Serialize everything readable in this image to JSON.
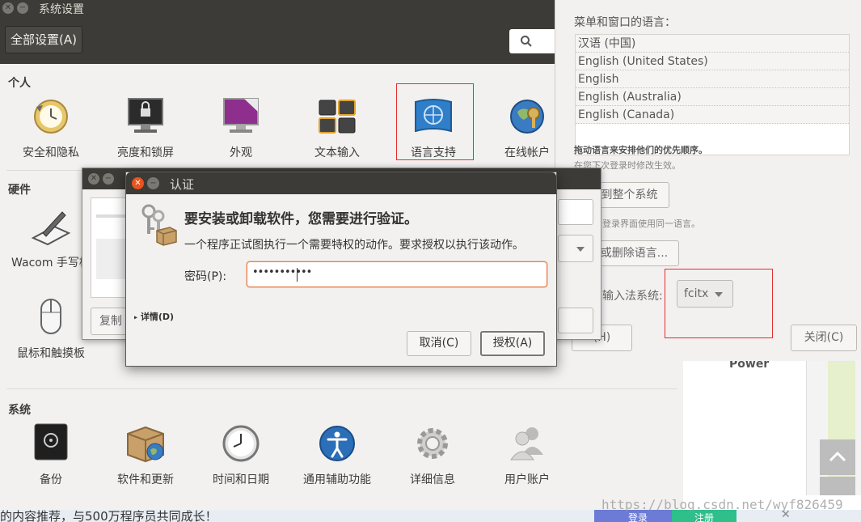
{
  "settings_window": {
    "title": "系统设置",
    "all_settings_button": "全部设置(A)",
    "sections": {
      "personal": {
        "title": "个人",
        "items": [
          "安全和隐私",
          "亮度和锁屏",
          "外观",
          "文本输入",
          "语言支持",
          "在线帐户"
        ]
      },
      "hardware": {
        "title": "硬件",
        "items": [
          "Wacom 手写板",
          "鼠标和触摸板"
        ]
      },
      "system": {
        "title": "系统",
        "items": [
          "备份",
          "软件和更新",
          "时间和日期",
          "通用辅助功能",
          "详细信息",
          "用户账户"
        ]
      }
    },
    "power_label": "Power"
  },
  "language_panel": {
    "menu_language_label": "菜单和窗口的语言：",
    "languages": [
      "汉语 (中国)",
      "English (United States)",
      "English",
      "English (Australia)",
      "English (Canada)"
    ],
    "drag_hint": "拖动语言来安排他们的优先顺序。",
    "effect_hint": "在您下次登录时修改生效。",
    "apply_system_button": "到整个系统",
    "login_hint": "登录界面使用同一语言。",
    "install_remove_button": "或删除语言...",
    "input_method_label": "输入法系统:",
    "input_method_value": "fcitx",
    "help_button": "(H)",
    "close_button": "关闭(C)"
  },
  "background_dialog": {
    "copy_button": "复制"
  },
  "auth_dialog": {
    "title": "认证",
    "heading": "要安装或卸载软件，您需要进行验证。",
    "message": "一个程序正试图执行一个需要特权的动作。要求授权以执行该动作。",
    "password_label": "密码(P):",
    "password_value": "•••••••••••",
    "details_label": "详情(D)",
    "cancel_button": "取消(C)",
    "authorize_button": "授权(A)"
  },
  "bottom_banner": {
    "text": "的内容推荐，与500万程序员共同成长！",
    "login": "登录",
    "register": "注册"
  },
  "watermark": "https://blog.csdn.net/wyf826459",
  "colors": {
    "titlebar": "#3c3b37",
    "window_bg": "#f2f1f0",
    "highlight_box": "#e03030",
    "focus_orange": "#e97c48"
  }
}
